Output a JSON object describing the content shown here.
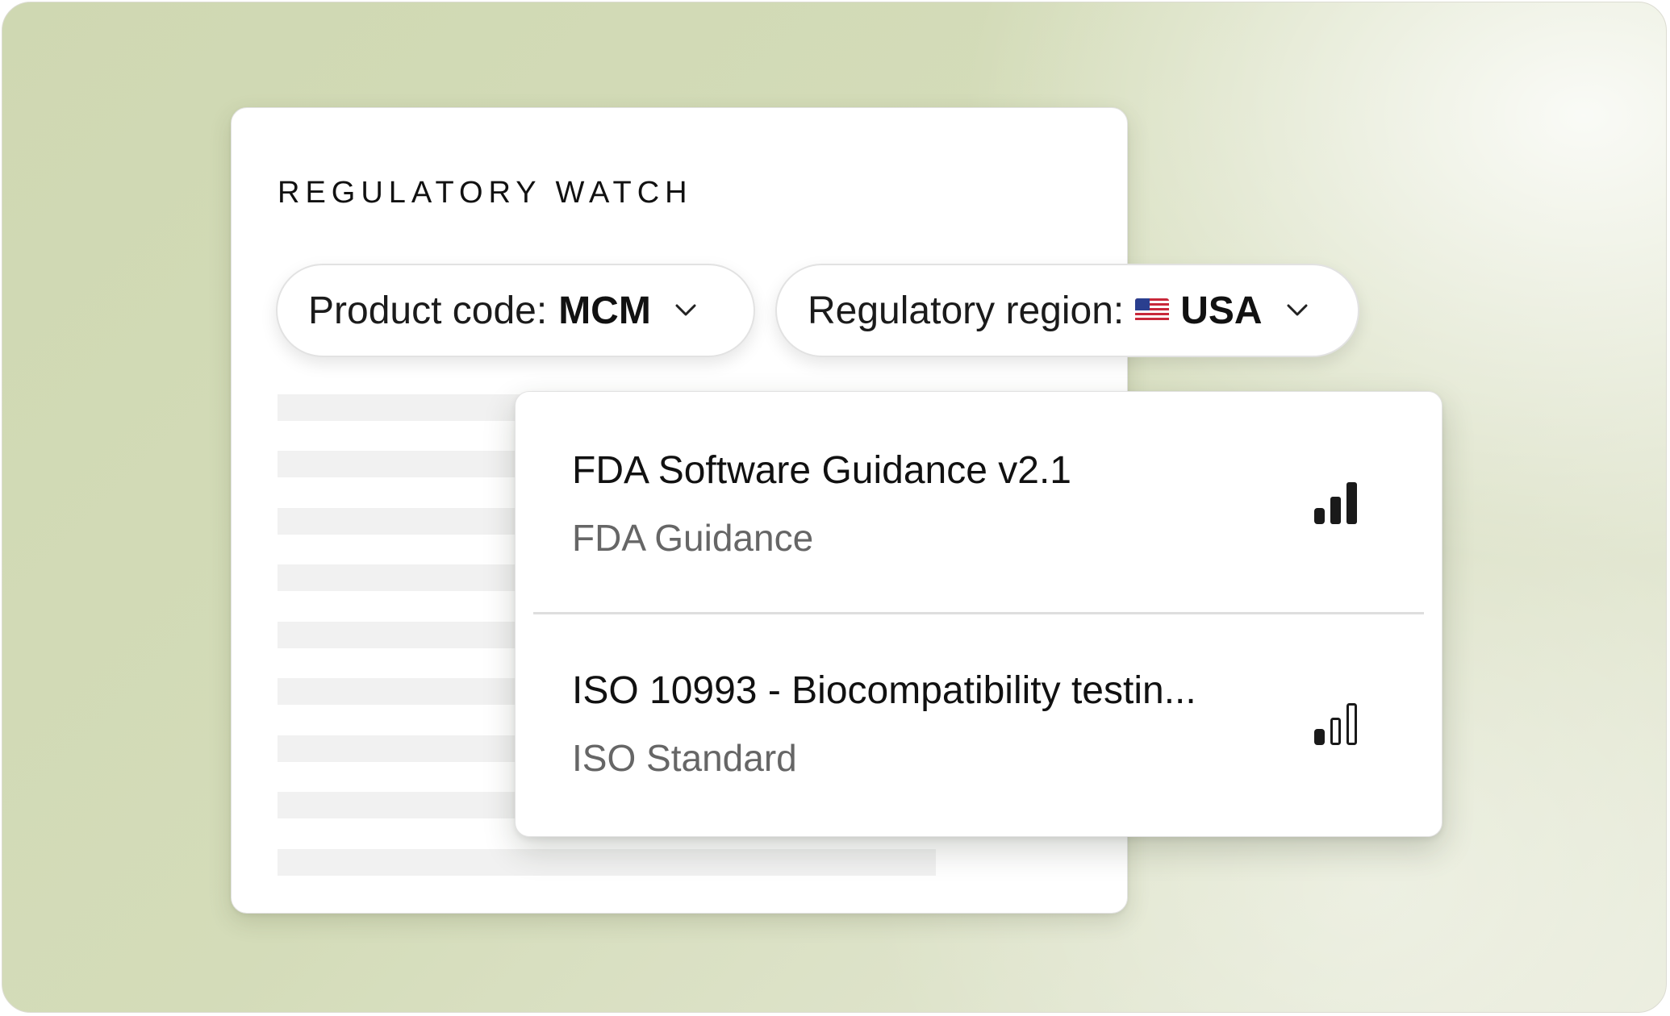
{
  "card": {
    "title": "REGULATORY WATCH"
  },
  "filters": {
    "product": {
      "label": "Product code:",
      "value": "MCM"
    },
    "region": {
      "label": "Regulatory region:",
      "flag": "us-flag-icon",
      "value": "USA"
    }
  },
  "results": [
    {
      "title": "FDA Software Guidance v2.1",
      "subtitle": "FDA Guidance",
      "relevance": "high",
      "relevance_level": 3
    },
    {
      "title": "ISO 10993 - Biocompatibility testin...",
      "subtitle": "ISO Standard",
      "relevance": "low",
      "relevance_level": 1
    }
  ],
  "colors": {
    "background": "#d4dcb9",
    "card": "#ffffff",
    "skeleton": "#f1f1f1",
    "subtitle": "#666666"
  }
}
